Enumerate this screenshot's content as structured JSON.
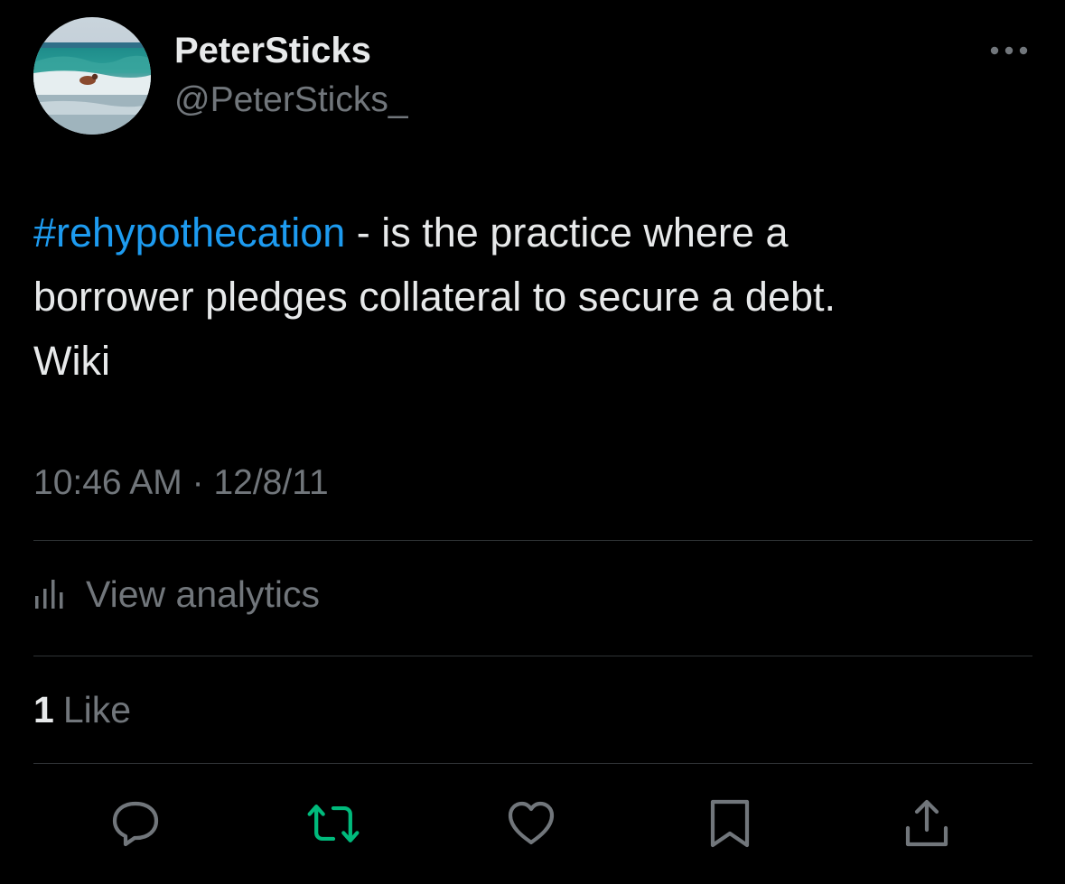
{
  "author": {
    "display_name": "PeterSticks",
    "handle": "@PeterSticks_"
  },
  "tweet": {
    "hashtag": "#rehypothecation",
    "text_line1": " - is the practice where a",
    "text_line2": "borrower pledges collateral to secure a debt.",
    "text_line3": "Wiki"
  },
  "meta": {
    "time": "10:46 AM",
    "separator": "·",
    "date": "12/8/11"
  },
  "analytics": {
    "label": "View analytics"
  },
  "engagement": {
    "likes_count": "1",
    "likes_label": "Like"
  },
  "icons": {
    "more": "more-horizontal-icon",
    "analytics": "bar-chart-icon",
    "reply": "reply-icon",
    "retweet": "retweet-icon",
    "like": "heart-icon",
    "bookmark": "bookmark-icon",
    "share": "share-icon"
  },
  "colors": {
    "background": "#000000",
    "text_primary": "#e7e9ea",
    "text_secondary": "#71767b",
    "link": "#1d9bf0",
    "retweet_active": "#00ba7c",
    "divider": "#2f3336"
  }
}
